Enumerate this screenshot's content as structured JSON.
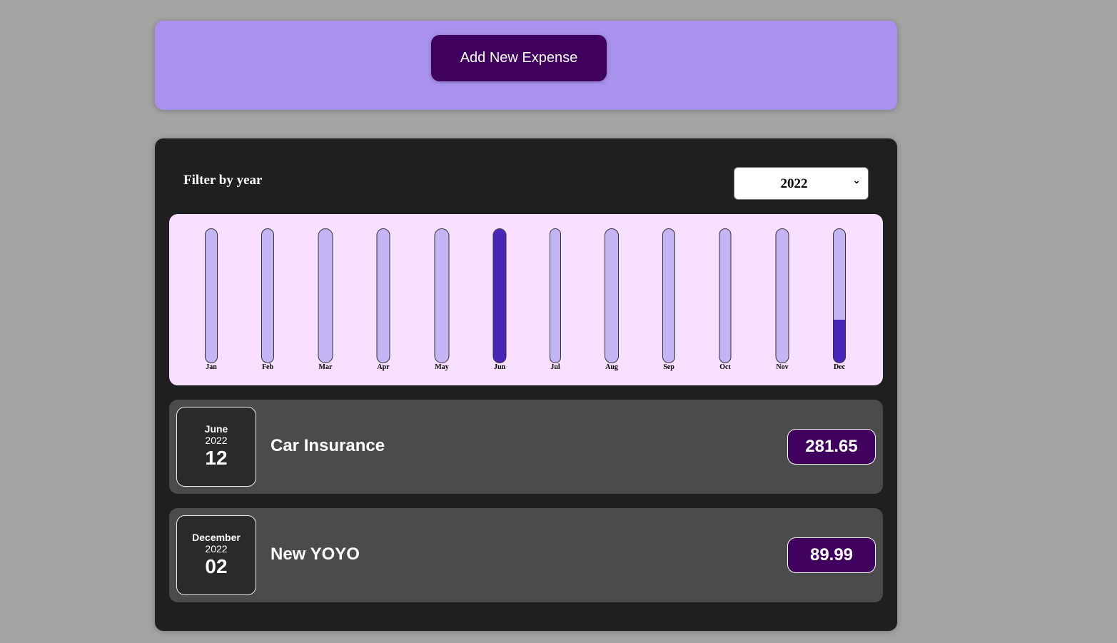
{
  "new_expense": {
    "add_button_label": "Add New Expense"
  },
  "filter": {
    "label": "Filter by year",
    "selected_year": "2022",
    "chevron_icon": "chevron-down-icon"
  },
  "chart_data": {
    "type": "bar",
    "categories": [
      "Jan",
      "Feb",
      "Mar",
      "Apr",
      "May",
      "Jun",
      "Jul",
      "Aug",
      "Sep",
      "Oct",
      "Nov",
      "Dec"
    ],
    "values": [
      0,
      0,
      0,
      0,
      0,
      281.65,
      0,
      0,
      0,
      0,
      0,
      89.99
    ],
    "max_value": 281.65,
    "colors": {
      "track": "#c3b4f3",
      "fill": "#4826b9",
      "background": "#f8dfff"
    }
  },
  "expenses": [
    {
      "month": "June",
      "year": "2022",
      "day": "12",
      "title": "Car Insurance",
      "amount": "281.65"
    },
    {
      "month": "December",
      "year": "2022",
      "day": "02",
      "title": "New YOYO",
      "amount": "89.99"
    }
  ],
  "colors": {
    "page_background": "#a3a3a3",
    "new_expense_panel": "#a892ee",
    "accent_dark_purple": "#40005d",
    "expenses_panel": "#1f1f1f",
    "expense_item": "#4b4b4b"
  }
}
